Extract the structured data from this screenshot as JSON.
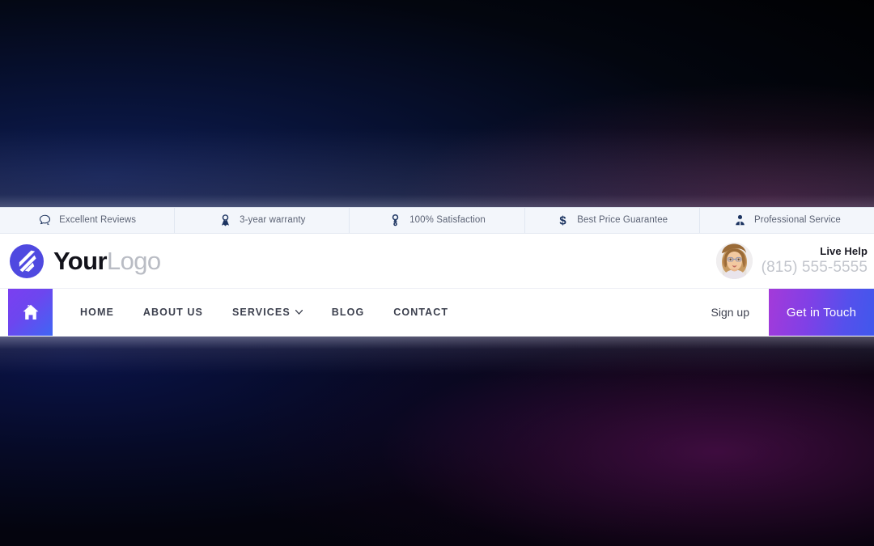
{
  "topbar": {
    "features": [
      {
        "icon": "chat-bubble-icon",
        "label": "Excellent Reviews"
      },
      {
        "icon": "ribbon-award-icon",
        "label": "3-year warranty"
      },
      {
        "icon": "medal-icon",
        "label": "100% Satisfaction"
      },
      {
        "icon": "dollar-sign-icon",
        "label": "Best Price Guarantee"
      },
      {
        "icon": "user-tie-icon",
        "label": "Professional Service"
      }
    ]
  },
  "header": {
    "logo_icon": "swoosh-circle-logo-icon",
    "brand_primary": "Your",
    "brand_secondary": "Logo",
    "help": {
      "avatar_icon": "support-agent-avatar",
      "title": "Live Help",
      "phone": "(815) 555-5555"
    }
  },
  "nav": {
    "home_icon": "home-icon",
    "items": [
      {
        "label": "HOME",
        "has_dropdown": false
      },
      {
        "label": "ABOUT US",
        "has_dropdown": false
      },
      {
        "label": "SERVICES",
        "has_dropdown": true
      },
      {
        "label": "BLOG",
        "has_dropdown": false
      },
      {
        "label": "CONTACT",
        "has_dropdown": false
      }
    ],
    "signup_label": "Sign up",
    "cta_label": "Get in Touch"
  },
  "colors": {
    "brand_violet": "#4f49e0",
    "cta_gradient_start": "#a43ad9",
    "cta_gradient_end": "#4058ec",
    "topbar_bg": "#f3f6fb",
    "icon_navy": "#1c3461",
    "phone_gray": "#c2c5cc"
  }
}
